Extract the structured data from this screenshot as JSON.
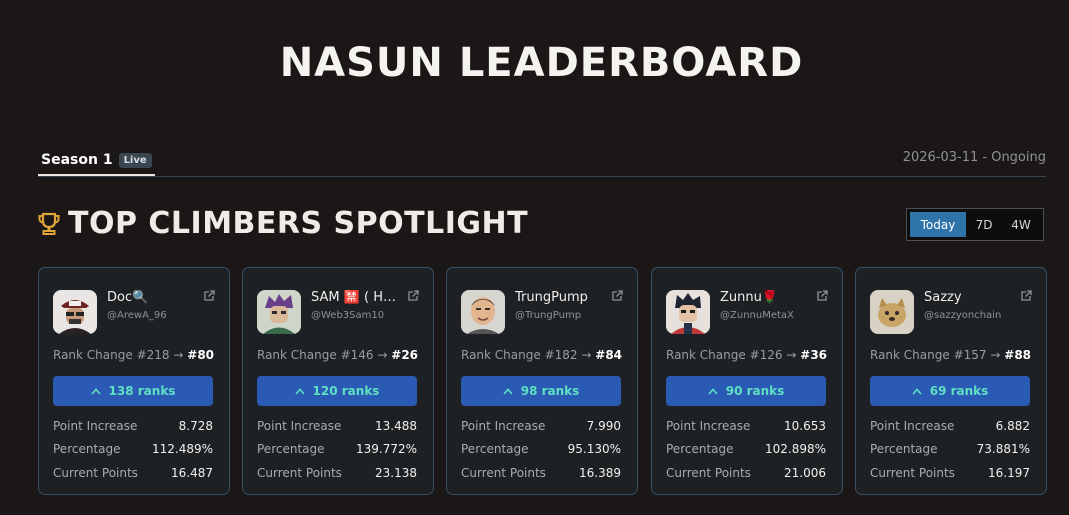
{
  "page_title": "NASUN LEADERBOARD",
  "season": {
    "label": "Season 1",
    "badge": "Live",
    "date_range": "2026-03-11 - Ongoing"
  },
  "spotlight": {
    "title": "TOP CLIMBERS SPOTLIGHT",
    "ranges": [
      "Today",
      "7D",
      "4W"
    ],
    "active_range": "Today",
    "labels": {
      "rank_change": "Rank Change",
      "point_increase": "Point Increase",
      "percentage": "Percentage",
      "current_points": "Current Points",
      "arrow": "→"
    }
  },
  "climbers": [
    {
      "name": "Doc🔍",
      "handle": "@ArewA_96",
      "from_rank": "#218",
      "to_rank": "#80",
      "ranks_gained": "138 ranks",
      "point_increase": "8.728",
      "percentage": "112.489%",
      "current_points": "16.487"
    },
    {
      "name": "SAM 🈲 ( H…",
      "handle": "@Web3Sam10",
      "from_rank": "#146",
      "to_rank": "#26",
      "ranks_gained": "120 ranks",
      "point_increase": "13.488",
      "percentage": "139.772%",
      "current_points": "23.138"
    },
    {
      "name": "TrungPump",
      "handle": "@TrungPump",
      "from_rank": "#182",
      "to_rank": "#84",
      "ranks_gained": "98 ranks",
      "point_increase": "7.990",
      "percentage": "95.130%",
      "current_points": "16.389"
    },
    {
      "name": "Zunnu🌹",
      "handle": "@ZunnuMetaX",
      "from_rank": "#126",
      "to_rank": "#36",
      "ranks_gained": "90 ranks",
      "point_increase": "10.653",
      "percentage": "102.898%",
      "current_points": "21.006"
    },
    {
      "name": "Sazzy",
      "handle": "@sazzyonchain",
      "from_rank": "#157",
      "to_rank": "#88",
      "ranks_gained": "69 ranks",
      "point_increase": "6.882",
      "percentage": "73.881%",
      "current_points": "16.197"
    }
  ],
  "colors": {
    "background": "#1a1716",
    "card_border": "#35516a",
    "ranks_button": "#2a5ab4",
    "ranks_text": "#5fe0c2",
    "active_toggle": "#2f74a8",
    "trophy": "#e0a53a"
  }
}
